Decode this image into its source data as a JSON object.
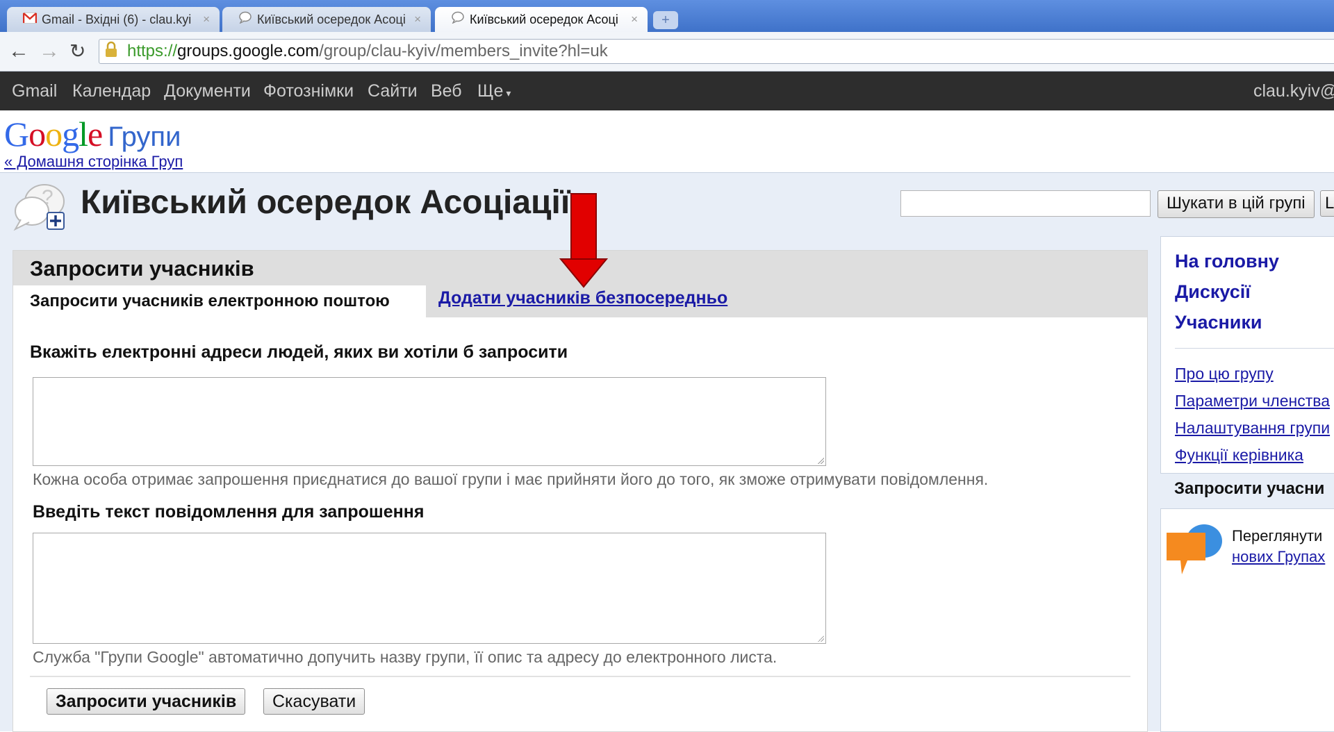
{
  "browser": {
    "tabs": [
      {
        "title": "Gmail - Вхідні (6) - clau.kyi",
        "icon": "gmail-icon",
        "active": false
      },
      {
        "title": "Київський осередок Асоці",
        "icon": "groups-icon",
        "active": false
      },
      {
        "title": "Київський осередок Асоці",
        "icon": "groups-icon",
        "active": true
      }
    ],
    "close_glyph": "×",
    "new_tab_glyph": "+",
    "url": {
      "scheme": "https://",
      "host": "groups.google.com",
      "path": "/group/clau-kyiv/members_invite?hl=uk"
    }
  },
  "gbar": {
    "items": [
      "Gmail",
      "Календар",
      "Документи",
      "Фотознімки",
      "Сайти",
      "Веб",
      "Ще"
    ],
    "more_caret": "▾",
    "account": "clau.kyiv@"
  },
  "header": {
    "logo_text": "Google",
    "product": "Групи",
    "home_link": "« Домашня сторінка Груп",
    "group_title": "Київський осередок Асоціації",
    "search_placeholder": "",
    "search_button": "Шукати в цій групі",
    "search_button2": "L"
  },
  "main": {
    "title": "Запросити учасників",
    "tabs": {
      "email": "Запросити учасників електронною поштою",
      "direct": "Додати учасників безпосередньо"
    },
    "emails_label": "Вкажіть електронні адреси людей, яких ви хотіли б запросити",
    "emails_value": "",
    "emails_hint": "Кожна особа отримає запрошення приєднатися до вашої групи і має прийняти його до того, як зможе отримувати повідомлення.",
    "message_label": "Введіть текст повідомлення для запрошення",
    "message_value": "",
    "message_hint": "Служба \"Групи Google\" автоматично допучить назву групи, її опис та адресу до електронного листа.",
    "invite_button": "Запросити учасників",
    "cancel_button": "Скасувати"
  },
  "annotation": {
    "arrow_color": "#e10000"
  },
  "sidebar": {
    "primary": [
      "На головну",
      "Дискусії",
      "Учасники"
    ],
    "secondary": [
      "Про цю групу",
      "Параметри членства",
      "Налаштування групи",
      "Функції керівника"
    ],
    "current": "Запросити учасни",
    "promo_text": "Переглянути",
    "promo_link": "нових Групах"
  },
  "colors": {
    "link": "#1a1aa6",
    "gbar_bg": "#2d2d2d",
    "band_bg": "#e8eef7"
  }
}
